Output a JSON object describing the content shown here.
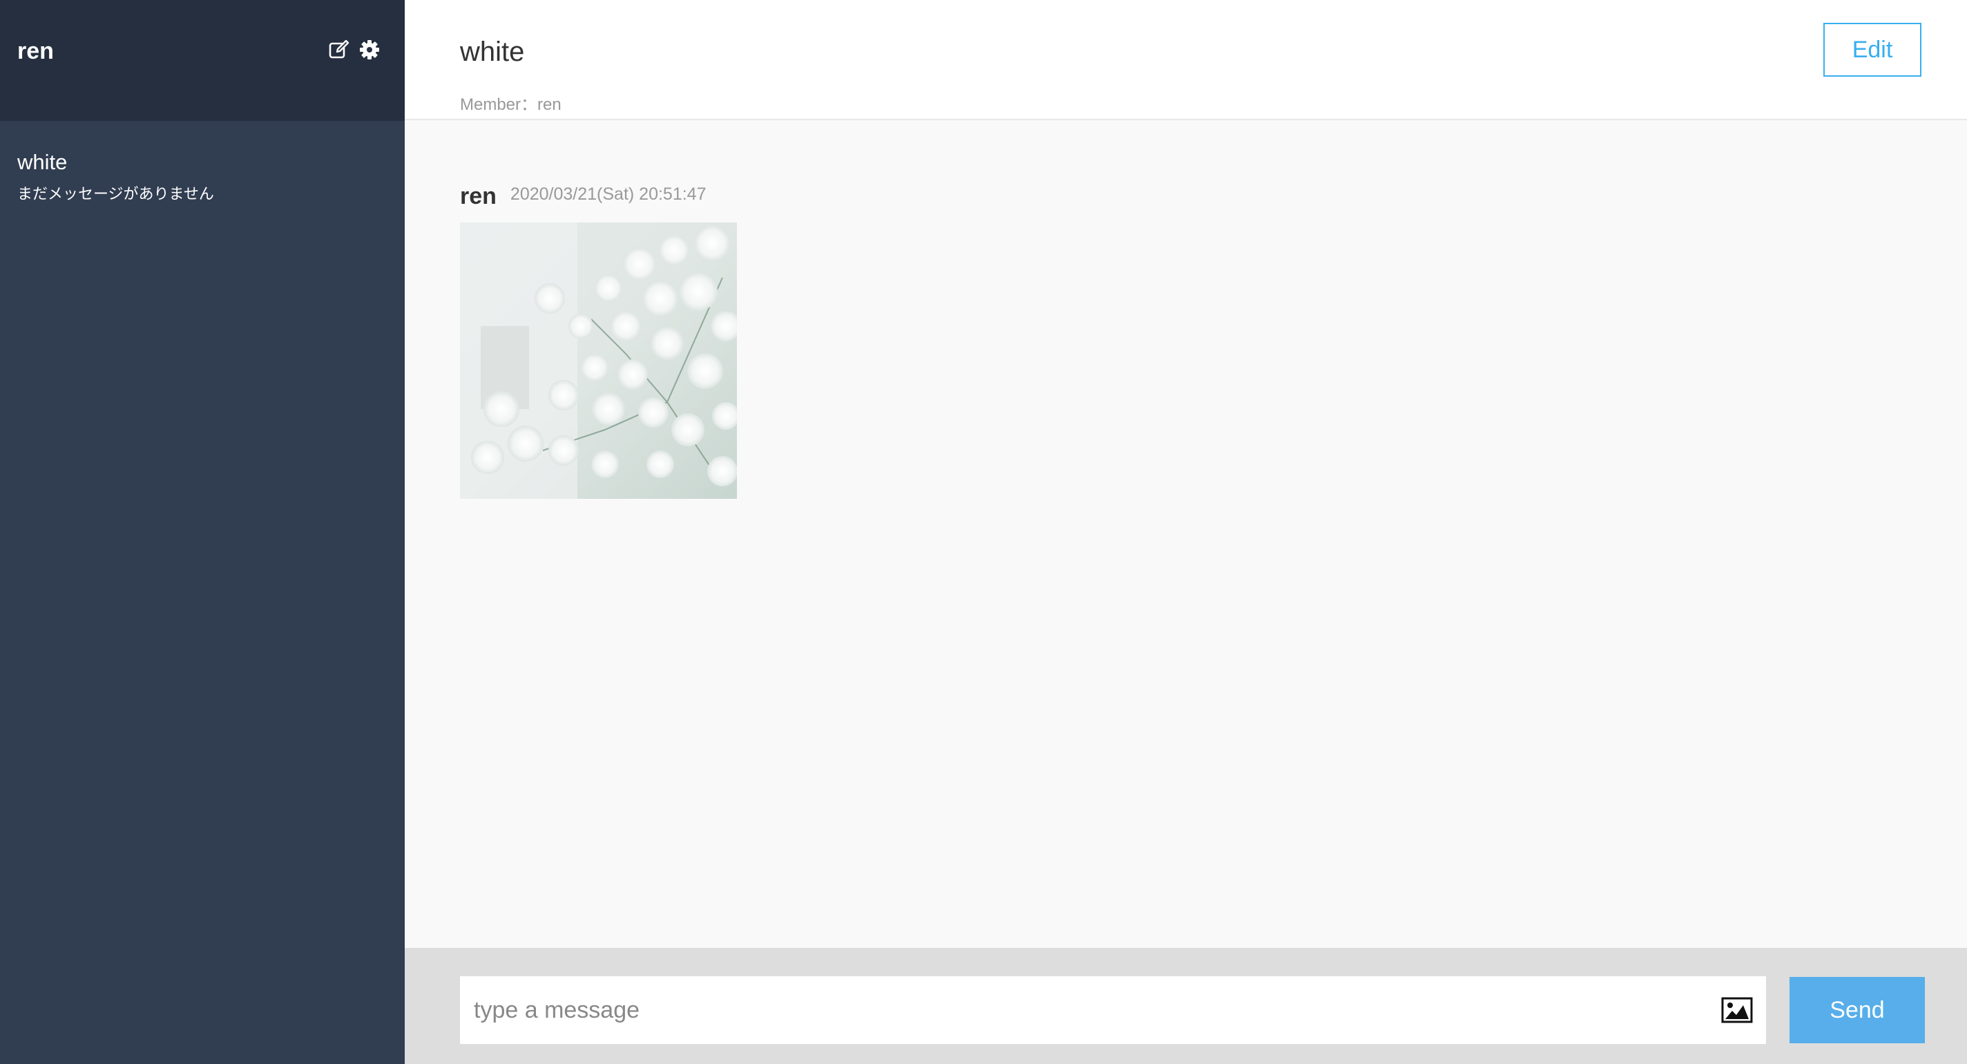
{
  "sidebar": {
    "user_name": "ren",
    "icons": {
      "edit": "edit-icon",
      "settings": "gear-icon"
    },
    "groups": [
      {
        "name": "white",
        "last_message": "まだメッセージがありません"
      }
    ]
  },
  "main": {
    "group_title": "white",
    "member_line": "Member：ren",
    "edit_label": "Edit",
    "messages": [
      {
        "user": "ren",
        "date": "2020/03/21(Sat) 20:51:47",
        "image": "white-flowers-photo"
      }
    ]
  },
  "footer": {
    "input_placeholder": "type a message",
    "image_icon": "image-icon",
    "send_label": "Send"
  },
  "colors": {
    "sidebar_bg": "#313d50",
    "sidebar_header_bg": "#262f3f",
    "accent": "#38aef0",
    "send_bg": "#57aeea"
  }
}
